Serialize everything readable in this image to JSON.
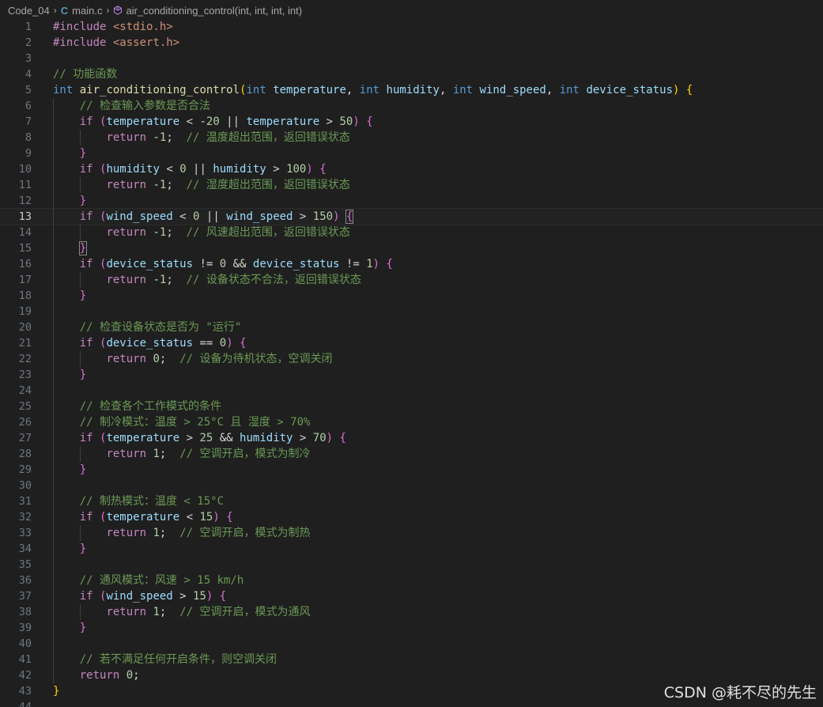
{
  "breadcrumb": {
    "folder": "Code_04",
    "file": "main.c",
    "symbol": "air_conditioning_control(int, int, int, int)",
    "file_icon": "c-language-icon",
    "symbol_icon": "method-cube-icon"
  },
  "editor": {
    "current_line": 13,
    "lines": [
      {
        "n": "1",
        "indent": 0,
        "tokens": [
          [
            "kw",
            "#include"
          ],
          [
            "op",
            " "
          ],
          [
            "str",
            "<stdio.h>"
          ]
        ]
      },
      {
        "n": "2",
        "indent": 0,
        "tokens": [
          [
            "kw",
            "#include"
          ],
          [
            "op",
            " "
          ],
          [
            "str",
            "<assert.h>"
          ]
        ]
      },
      {
        "n": "3",
        "indent": 0,
        "tokens": []
      },
      {
        "n": "4",
        "indent": 0,
        "tokens": [
          [
            "cmt",
            "// 功能函数"
          ]
        ]
      },
      {
        "n": "5",
        "indent": 0,
        "tokens": [
          [
            "type",
            "int"
          ],
          [
            "op",
            " "
          ],
          [
            "fn",
            "air_conditioning_control"
          ],
          [
            "p1",
            "("
          ],
          [
            "type",
            "int"
          ],
          [
            "op",
            " "
          ],
          [
            "var",
            "temperature"
          ],
          [
            "op",
            ", "
          ],
          [
            "type",
            "int"
          ],
          [
            "op",
            " "
          ],
          [
            "var",
            "humidity"
          ],
          [
            "op",
            ", "
          ],
          [
            "type",
            "int"
          ],
          [
            "op",
            " "
          ],
          [
            "var",
            "wind_speed"
          ],
          [
            "op",
            ", "
          ],
          [
            "type",
            "int"
          ],
          [
            "op",
            " "
          ],
          [
            "var",
            "device_status"
          ],
          [
            "p1",
            ")"
          ],
          [
            "op",
            " "
          ],
          [
            "p1",
            "{"
          ]
        ]
      },
      {
        "n": "6",
        "indent": 1,
        "tokens": [
          [
            "cmt",
            "    // 检查输入参数是否合法"
          ]
        ]
      },
      {
        "n": "7",
        "indent": 1,
        "tokens": [
          [
            "op",
            "    "
          ],
          [
            "kw",
            "if"
          ],
          [
            "op",
            " "
          ],
          [
            "p2",
            "("
          ],
          [
            "var",
            "temperature"
          ],
          [
            "op",
            " < -"
          ],
          [
            "num",
            "20"
          ],
          [
            "op",
            " || "
          ],
          [
            "var",
            "temperature"
          ],
          [
            "op",
            " > "
          ],
          [
            "num",
            "50"
          ],
          [
            "p2",
            ")"
          ],
          [
            "op",
            " "
          ],
          [
            "p2",
            "{"
          ]
        ]
      },
      {
        "n": "8",
        "indent": 2,
        "tokens": [
          [
            "op",
            "        "
          ],
          [
            "kw",
            "return"
          ],
          [
            "op",
            " -"
          ],
          [
            "num",
            "1"
          ],
          [
            "op",
            ";  "
          ],
          [
            "cmt",
            "// 温度超出范围，返回错误状态"
          ]
        ]
      },
      {
        "n": "9",
        "indent": 1,
        "tokens": [
          [
            "op",
            "    "
          ],
          [
            "p2",
            "}"
          ]
        ]
      },
      {
        "n": "10",
        "indent": 1,
        "tokens": [
          [
            "op",
            "    "
          ],
          [
            "kw",
            "if"
          ],
          [
            "op",
            " "
          ],
          [
            "p2",
            "("
          ],
          [
            "var",
            "humidity"
          ],
          [
            "op",
            " < "
          ],
          [
            "num",
            "0"
          ],
          [
            "op",
            " || "
          ],
          [
            "var",
            "humidity"
          ],
          [
            "op",
            " > "
          ],
          [
            "num",
            "100"
          ],
          [
            "p2",
            ")"
          ],
          [
            "op",
            " "
          ],
          [
            "p2",
            "{"
          ]
        ]
      },
      {
        "n": "11",
        "indent": 2,
        "tokens": [
          [
            "op",
            "        "
          ],
          [
            "kw",
            "return"
          ],
          [
            "op",
            " -"
          ],
          [
            "num",
            "1"
          ],
          [
            "op",
            ";  "
          ],
          [
            "cmt",
            "// 湿度超出范围，返回错误状态"
          ]
        ]
      },
      {
        "n": "12",
        "indent": 1,
        "tokens": [
          [
            "op",
            "    "
          ],
          [
            "p2",
            "}"
          ]
        ]
      },
      {
        "n": "13",
        "indent": 1,
        "tokens": [
          [
            "op",
            "    "
          ],
          [
            "kw",
            "if"
          ],
          [
            "op",
            " "
          ],
          [
            "p2",
            "("
          ],
          [
            "var",
            "wind_speed"
          ],
          [
            "op",
            " < "
          ],
          [
            "num",
            "0"
          ],
          [
            "op",
            " || "
          ],
          [
            "var",
            "wind_speed"
          ],
          [
            "op",
            " > "
          ],
          [
            "num",
            "150"
          ],
          [
            "p2",
            ")"
          ],
          [
            "op",
            " "
          ],
          [
            "p2m",
            "{"
          ]
        ]
      },
      {
        "n": "14",
        "indent": 2,
        "tokens": [
          [
            "op",
            "        "
          ],
          [
            "kw",
            "return"
          ],
          [
            "op",
            " -"
          ],
          [
            "num",
            "1"
          ],
          [
            "op",
            ";  "
          ],
          [
            "cmt",
            "// 风速超出范围，返回错误状态"
          ]
        ]
      },
      {
        "n": "15",
        "indent": 1,
        "tokens": [
          [
            "op",
            "    "
          ],
          [
            "p2m",
            "}"
          ]
        ]
      },
      {
        "n": "16",
        "indent": 1,
        "tokens": [
          [
            "op",
            "    "
          ],
          [
            "kw",
            "if"
          ],
          [
            "op",
            " "
          ],
          [
            "p2",
            "("
          ],
          [
            "var",
            "device_status"
          ],
          [
            "op",
            " != "
          ],
          [
            "num",
            "0"
          ],
          [
            "op",
            " && "
          ],
          [
            "var",
            "device_status"
          ],
          [
            "op",
            " != "
          ],
          [
            "num",
            "1"
          ],
          [
            "p2",
            ")"
          ],
          [
            "op",
            " "
          ],
          [
            "p2",
            "{"
          ]
        ]
      },
      {
        "n": "17",
        "indent": 2,
        "tokens": [
          [
            "op",
            "        "
          ],
          [
            "kw",
            "return"
          ],
          [
            "op",
            " -"
          ],
          [
            "num",
            "1"
          ],
          [
            "op",
            ";  "
          ],
          [
            "cmt",
            "// 设备状态不合法，返回错误状态"
          ]
        ]
      },
      {
        "n": "18",
        "indent": 1,
        "tokens": [
          [
            "op",
            "    "
          ],
          [
            "p2",
            "}"
          ]
        ]
      },
      {
        "n": "19",
        "indent": 1,
        "tokens": []
      },
      {
        "n": "20",
        "indent": 1,
        "tokens": [
          [
            "cmt",
            "    // 检查设备状态是否为 \"运行\""
          ]
        ]
      },
      {
        "n": "21",
        "indent": 1,
        "tokens": [
          [
            "op",
            "    "
          ],
          [
            "kw",
            "if"
          ],
          [
            "op",
            " "
          ],
          [
            "p2",
            "("
          ],
          [
            "var",
            "device_status"
          ],
          [
            "op",
            " == "
          ],
          [
            "num",
            "0"
          ],
          [
            "p2",
            ")"
          ],
          [
            "op",
            " "
          ],
          [
            "p2",
            "{"
          ]
        ]
      },
      {
        "n": "22",
        "indent": 2,
        "tokens": [
          [
            "op",
            "        "
          ],
          [
            "kw",
            "return"
          ],
          [
            "op",
            " "
          ],
          [
            "num",
            "0"
          ],
          [
            "op",
            ";  "
          ],
          [
            "cmt",
            "// 设备为待机状态，空调关闭"
          ]
        ]
      },
      {
        "n": "23",
        "indent": 1,
        "tokens": [
          [
            "op",
            "    "
          ],
          [
            "p2",
            "}"
          ]
        ]
      },
      {
        "n": "24",
        "indent": 1,
        "tokens": []
      },
      {
        "n": "25",
        "indent": 1,
        "tokens": [
          [
            "cmt",
            "    // 检查各个工作模式的条件"
          ]
        ]
      },
      {
        "n": "26",
        "indent": 1,
        "tokens": [
          [
            "cmt",
            "    // 制冷模式：温度 > 25°C 且 湿度 > 70%"
          ]
        ]
      },
      {
        "n": "27",
        "indent": 1,
        "tokens": [
          [
            "op",
            "    "
          ],
          [
            "kw",
            "if"
          ],
          [
            "op",
            " "
          ],
          [
            "p2",
            "("
          ],
          [
            "var",
            "temperature"
          ],
          [
            "op",
            " > "
          ],
          [
            "num",
            "25"
          ],
          [
            "op",
            " && "
          ],
          [
            "var",
            "humidity"
          ],
          [
            "op",
            " > "
          ],
          [
            "num",
            "70"
          ],
          [
            "p2",
            ")"
          ],
          [
            "op",
            " "
          ],
          [
            "p2",
            "{"
          ]
        ]
      },
      {
        "n": "28",
        "indent": 2,
        "tokens": [
          [
            "op",
            "        "
          ],
          [
            "kw",
            "return"
          ],
          [
            "op",
            " "
          ],
          [
            "num",
            "1"
          ],
          [
            "op",
            ";  "
          ],
          [
            "cmt",
            "// 空调开启，模式为制冷"
          ]
        ]
      },
      {
        "n": "29",
        "indent": 1,
        "tokens": [
          [
            "op",
            "    "
          ],
          [
            "p2",
            "}"
          ]
        ]
      },
      {
        "n": "30",
        "indent": 1,
        "tokens": []
      },
      {
        "n": "31",
        "indent": 1,
        "tokens": [
          [
            "cmt",
            "    // 制热模式：温度 < 15°C"
          ]
        ]
      },
      {
        "n": "32",
        "indent": 1,
        "tokens": [
          [
            "op",
            "    "
          ],
          [
            "kw",
            "if"
          ],
          [
            "op",
            " "
          ],
          [
            "p2",
            "("
          ],
          [
            "var",
            "temperature"
          ],
          [
            "op",
            " < "
          ],
          [
            "num",
            "15"
          ],
          [
            "p2",
            ")"
          ],
          [
            "op",
            " "
          ],
          [
            "p2",
            "{"
          ]
        ]
      },
      {
        "n": "33",
        "indent": 2,
        "tokens": [
          [
            "op",
            "        "
          ],
          [
            "kw",
            "return"
          ],
          [
            "op",
            " "
          ],
          [
            "num",
            "1"
          ],
          [
            "op",
            ";  "
          ],
          [
            "cmt",
            "// 空调开启，模式为制热"
          ]
        ]
      },
      {
        "n": "34",
        "indent": 1,
        "tokens": [
          [
            "op",
            "    "
          ],
          [
            "p2",
            "}"
          ]
        ]
      },
      {
        "n": "35",
        "indent": 1,
        "tokens": []
      },
      {
        "n": "36",
        "indent": 1,
        "tokens": [
          [
            "cmt",
            "    // 通风模式：风速 > 15 km/h"
          ]
        ]
      },
      {
        "n": "37",
        "indent": 1,
        "tokens": [
          [
            "op",
            "    "
          ],
          [
            "kw",
            "if"
          ],
          [
            "op",
            " "
          ],
          [
            "p2",
            "("
          ],
          [
            "var",
            "wind_speed"
          ],
          [
            "op",
            " > "
          ],
          [
            "num",
            "15"
          ],
          [
            "p2",
            ")"
          ],
          [
            "op",
            " "
          ],
          [
            "p2",
            "{"
          ]
        ]
      },
      {
        "n": "38",
        "indent": 2,
        "tokens": [
          [
            "op",
            "        "
          ],
          [
            "kw",
            "return"
          ],
          [
            "op",
            " "
          ],
          [
            "num",
            "1"
          ],
          [
            "op",
            ";  "
          ],
          [
            "cmt",
            "// 空调开启，模式为通风"
          ]
        ]
      },
      {
        "n": "39",
        "indent": 1,
        "tokens": [
          [
            "op",
            "    "
          ],
          [
            "p2",
            "}"
          ]
        ]
      },
      {
        "n": "40",
        "indent": 1,
        "tokens": []
      },
      {
        "n": "41",
        "indent": 1,
        "tokens": [
          [
            "cmt",
            "    // 若不满足任何开启条件，则空调关闭"
          ]
        ]
      },
      {
        "n": "42",
        "indent": 1,
        "tokens": [
          [
            "op",
            "    "
          ],
          [
            "kw",
            "return"
          ],
          [
            "op",
            " "
          ],
          [
            "num",
            "0"
          ],
          [
            "op",
            ";"
          ]
        ]
      },
      {
        "n": "43",
        "indent": 0,
        "tokens": [
          [
            "p1",
            "}"
          ]
        ]
      },
      {
        "n": "44",
        "indent": 0,
        "tokens": []
      }
    ]
  },
  "watermark": "CSDN @耗不尽的先生"
}
